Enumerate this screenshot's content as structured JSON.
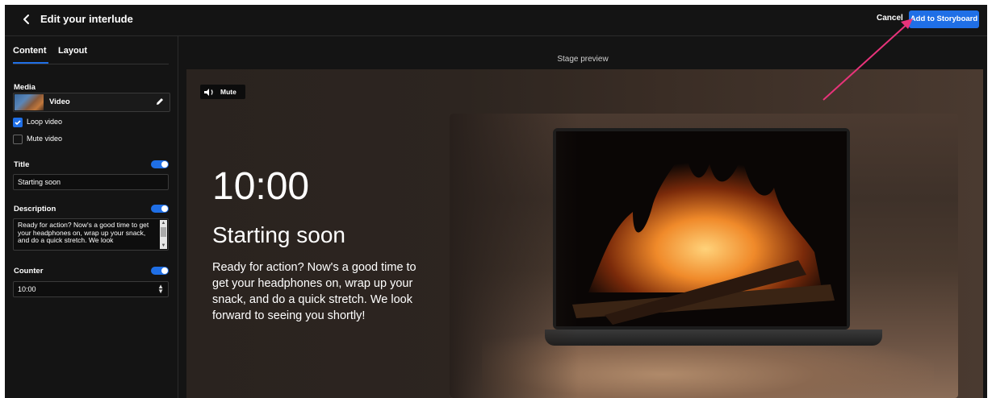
{
  "header": {
    "back_icon": "chevron-left-icon",
    "title": "Edit your interlude",
    "cancel_label": "Cancel",
    "add_label": "Add to Storyboard",
    "accent_color": "#1f6fe6"
  },
  "sidebar": {
    "tabs": [
      {
        "label": "Content",
        "active": true
      },
      {
        "label": "Layout",
        "active": false
      }
    ],
    "media": {
      "section_label": "Media",
      "item_label": "Video",
      "edit_icon": "pencil-icon",
      "options": [
        {
          "label": "Loop video",
          "checked": true
        },
        {
          "label": "Mute video",
          "checked": false
        }
      ]
    },
    "title_field": {
      "label": "Title",
      "enabled": true,
      "value": "Starting soon"
    },
    "description_field": {
      "label": "Description",
      "enabled": true,
      "value": "Ready for action? Now's a good time to get your headphones on, wrap up your snack, and do a quick stretch. We look"
    },
    "counter_field": {
      "label": "Counter",
      "enabled": true,
      "value": "10:00"
    }
  },
  "preview": {
    "stage_label": "Stage preview",
    "mute_label": "Mute",
    "mute_icon": "speaker-icon",
    "counter": "10:00",
    "title": "Starting soon",
    "description": "Ready for action? Now's a good time to get your headphones on, wrap up your snack, and do a quick stretch. We look forward to seeing you shortly!"
  },
  "annotation": {
    "arrow_color": "#e8337a"
  }
}
